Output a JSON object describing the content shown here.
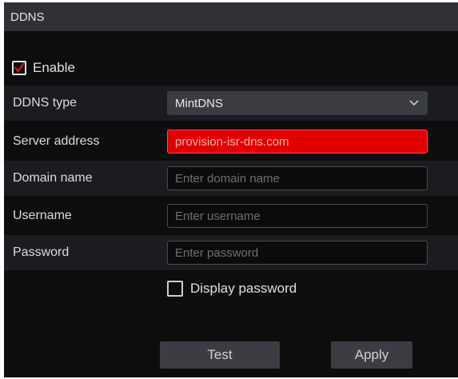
{
  "header": {
    "title": "DDNS"
  },
  "enable": {
    "label": "Enable",
    "checked": true,
    "check_color": "#e01010"
  },
  "form": {
    "ddns_type": {
      "label": "DDNS type",
      "value": "MintDNS"
    },
    "server_address": {
      "label": "Server address",
      "value": "provision-isr-dns.com",
      "highlight_color": "#e00000"
    },
    "domain_name": {
      "label": "Domain name",
      "placeholder": "Enter domain name"
    },
    "username": {
      "label": "Username",
      "placeholder": "Enter username"
    },
    "password": {
      "label": "Password",
      "placeholder": "Enter password"
    }
  },
  "display_password": {
    "label": "Display password",
    "checked": false
  },
  "actions": {
    "test_label": "Test",
    "apply_label": "Apply"
  },
  "icons": {
    "enable_check": "checkmark-icon",
    "dropdown": "chevron-down-icon"
  }
}
